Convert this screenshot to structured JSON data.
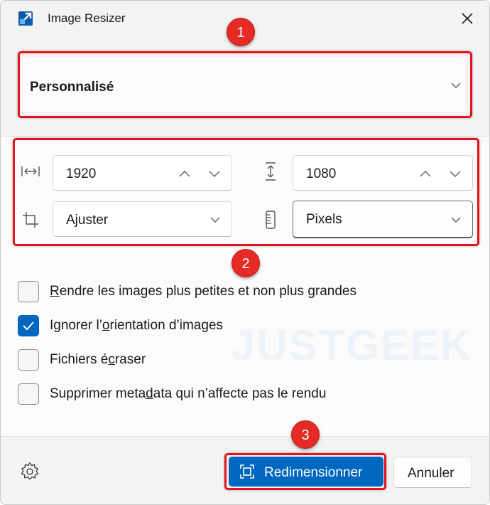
{
  "window": {
    "title": "Image Resizer",
    "app_icon": "image-resizer-icon",
    "close_icon": "close-icon"
  },
  "preset": {
    "selected": "Personnalisé"
  },
  "dimensions": {
    "width": {
      "icon": "width-arrows-icon",
      "value": "1920"
    },
    "height": {
      "icon": "height-arrows-icon",
      "value": "1080"
    },
    "fit": {
      "icon": "crop-icon",
      "value": "Ajuster"
    },
    "unit": {
      "icon": "ruler-icon",
      "value": "Pixels"
    }
  },
  "options": [
    {
      "label_pre": "",
      "mnemonic": "R",
      "label_post": "endre les images plus petites et non plus grandes",
      "checked": false
    },
    {
      "label_pre": "Ignorer l’",
      "mnemonic": "o",
      "label_post": "rientation d’images",
      "checked": true
    },
    {
      "label_pre": "Fichiers é",
      "mnemonic": "c",
      "label_post": "raser",
      "checked": false
    },
    {
      "label_pre": "Supprimer meta",
      "mnemonic": "d",
      "label_post": "ata qui n’affecte pas le rendu",
      "checked": false
    }
  ],
  "watermark": "JUSTGEEK",
  "footer": {
    "settings_icon": "gear-icon",
    "resize_label": "Redimensionner",
    "resize_icon": "resize-frame-icon",
    "cancel_label": "Annuler"
  },
  "annotations": {
    "badge_1": "1",
    "badge_2": "2",
    "badge_3": "3",
    "color": "#e3141b"
  },
  "colors": {
    "accent": "#0067c0",
    "background": "#f3f3f3"
  }
}
